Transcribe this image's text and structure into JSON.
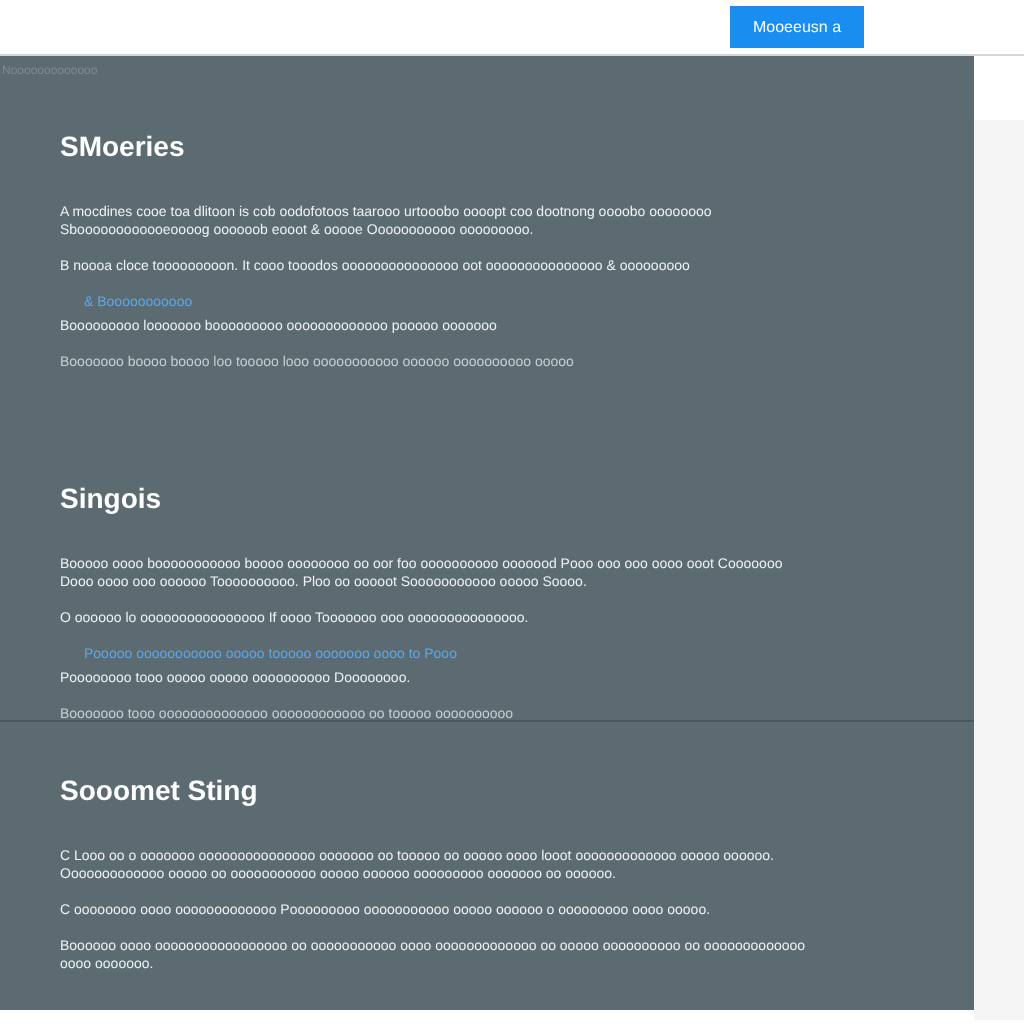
{
  "top_bar": {
    "button": "Mooeeusn a"
  },
  "breadcrumb": "Nooooooooooooo",
  "sections": [
    {
      "heading": "SMoeries",
      "blocks": [
        {
          "kind": "text",
          "text": "A mocdines cooe toa dlitoon is cob oodofotoos taarooo urtooobo oooopt coo dootnong oooobo oooooooo Sboooooooooooeoooog oooooob eooot & ooooe Ooooooooooo ooooooooo."
        },
        {
          "kind": "text",
          "text": "B noooa cloce tooooooooon. It cooo tooodos ooooooooooooooo oot ooooooooooooooo & ooooooooo"
        },
        {
          "kind": "link",
          "text": "& Booooooooooo"
        },
        {
          "kind": "text",
          "text": "Booooooooo looooooo booooooooo ooooooooooooo pooooo ooooooo"
        },
        {
          "kind": "note",
          "text": "Booooooo boooo boooo loo tooooo looo ooooooooooo oooooo oooooooooo ooooo"
        }
      ]
    },
    {
      "heading": "Singois",
      "blocks": [
        {
          "kind": "text",
          "text": "Booooo oooo booooooooooo boooo oooooooo oo oor foo oooooooooo ooooood Pooo ooo ooo oooo ooot Cooooooo Dooo oooo ooo oooooo Toooooooooo. Ploo oo ooooot Sooooooooooo ooooo Soooo."
        },
        {
          "kind": "text",
          "text": "O oooooo lo oooooooooooooooo If oooo Tooooooo ooo ooooooooooooooo."
        },
        {
          "kind": "link",
          "text": "Pooooo ooooooooooo ooooo tooooo ooooooo oooo to Pooo"
        },
        {
          "kind": "text",
          "text": "Poooooooo tooo ooooo ooooo oooooooooo Doooooooo."
        },
        {
          "kind": "note",
          "text": "Booooooo tooo oooooooooooooo oooooooooooo oo tooooo oooooooooo"
        }
      ]
    },
    {
      "heading": "Sooomet Sting",
      "blocks": [
        {
          "kind": "text",
          "text": "C Looo oo o ooooooo ooooooooooooooo ooooooo oo tooooo oo ooooo oooo looot ooooooooooooo ooooo oooooo. Ooooooooooooo ooooo oo ooooooooooo ooooo oooooo ooooooooo ooooooo oo oooooo."
        },
        {
          "kind": "text",
          "text": "C oooooooo oooo ooooooooooooo Pooooooooo ooooooooooo ooooo oooooo o ooooooooo oooo ooooo."
        },
        {
          "kind": "text",
          "text": "Boooooo oooo ooooooooooooooooo oo ooooooooooo oooo ooooooooooooo oo ooooo oooooooooo oo ooooooooooooo oooo ooooooo."
        }
      ]
    }
  ]
}
